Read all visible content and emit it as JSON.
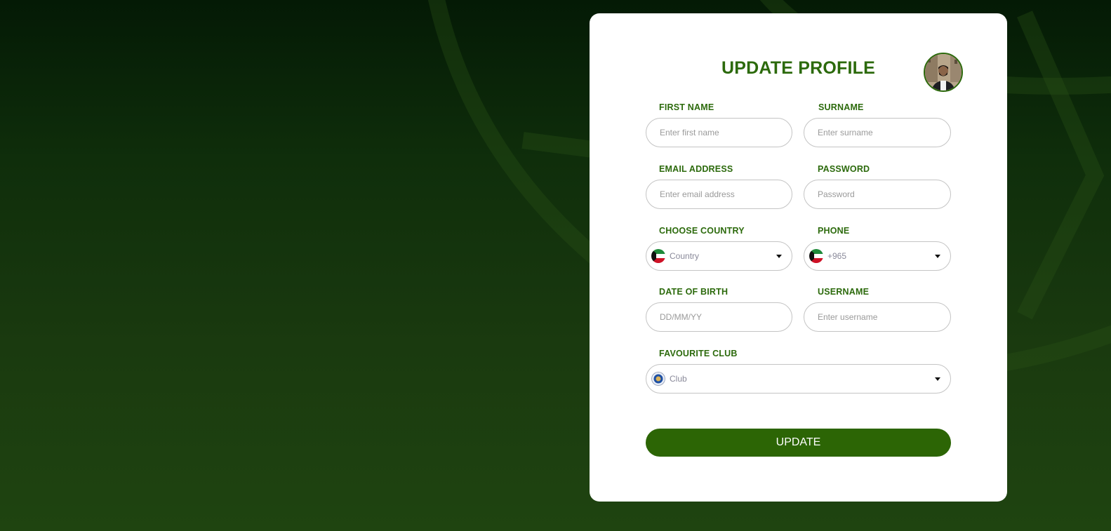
{
  "form": {
    "title": "UPDATE PROFILE",
    "fields": {
      "first_name": {
        "label": "FIRST NAME",
        "placeholder": "Enter first name",
        "value": ""
      },
      "surname": {
        "label": "SURNAME",
        "placeholder": "Enter surname",
        "value": ""
      },
      "email": {
        "label": "EMAIL ADDRESS",
        "placeholder": "Enter email address",
        "value": ""
      },
      "password": {
        "label": "PASSWORD",
        "placeholder": "Password",
        "value": ""
      },
      "country": {
        "label": "CHOOSE COUNTRY",
        "selected": "Country",
        "flag_icon": "kuwait-flag-icon"
      },
      "phone": {
        "label": "PHONE",
        "selected": "+965",
        "flag_icon": "kuwait-flag-icon"
      },
      "dob": {
        "label": "DATE OF BIRTH",
        "placeholder": "DD/MM/YY",
        "value": ""
      },
      "username": {
        "label": "USERNAME",
        "placeholder": "Enter username",
        "value": ""
      },
      "club": {
        "label": "FAVOURITE CLUB",
        "selected": "Club",
        "crest_icon": "club-crest-icon"
      }
    },
    "submit_label": "UPDATE"
  },
  "colors": {
    "accent": "#2c6a0c",
    "button": "#2c6505",
    "background_dark": "#041a05",
    "background_light": "#1f4410"
  }
}
